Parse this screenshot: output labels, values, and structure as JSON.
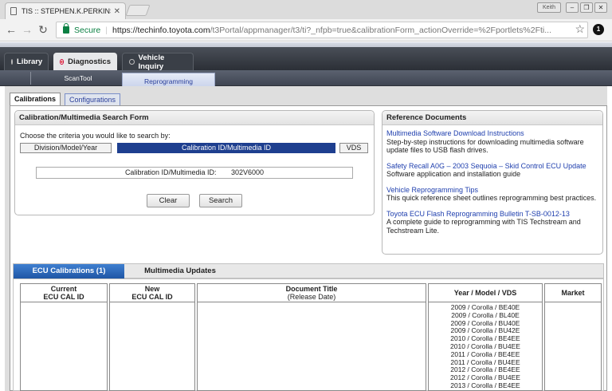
{
  "browser": {
    "tab_title": "TIS :: STEPHEN.K.PERKINS",
    "tab_close": "✕",
    "window_user": "Keith",
    "url_secure_label": "Secure",
    "url_host": "https://techinfo.toyota.com",
    "url_path": "/t3Portal/appmanager/t3/ti?_nfpb=true&calibrationForm_actionOverride=%2Fportlets%2Fti...",
    "ext_badge": "1"
  },
  "app_tabs": [
    {
      "label": "Library"
    },
    {
      "label": "Diagnostics"
    },
    {
      "label": "Vehicle Inquiry"
    }
  ],
  "sub_tabs": [
    {
      "label": "ScanTool"
    },
    {
      "label": "Reprogramming"
    }
  ],
  "cal_tabs": [
    {
      "label": "Calibrations"
    },
    {
      "label": "Configurations"
    }
  ],
  "search_form": {
    "title": "Calibration/Multimedia Search Form",
    "criteria_label": "Choose the criteria you would like to search by:",
    "criteria_buttons": [
      "Division/Model/Year",
      "Calibration ID/Multimedia ID",
      "VDS"
    ],
    "id_field_label": "Calibration ID/Multimedia ID:",
    "id_field_value": "302V6000",
    "clear_label": "Clear",
    "search_label": "Search"
  },
  "reference_docs": {
    "title": "Reference Documents",
    "items": [
      {
        "link": "Multimedia Software Download Instructions",
        "desc": "Step-by-step instructions for downloading multimedia software update files to USB flash drives."
      },
      {
        "link": "Safety Recall A0G – 2003 Sequoia – Skid Control ECU Update",
        "desc": "Software application and installation guide"
      },
      {
        "link": "Vehicle Reprogramming Tips",
        "desc": "This quick reference sheet outlines reprogramming best practices."
      },
      {
        "link": "Toyota ECU Flash Reprogramming Bulletin T-SB-0012-13",
        "desc": "A complete guide to reprogramming with TIS Techstream and Techstream Lite."
      }
    ]
  },
  "results": {
    "tabs": [
      "ECU Calibrations (1)",
      "Multimedia Updates"
    ],
    "columns": {
      "current_a": "Current",
      "current_b": "ECU CAL ID",
      "new_a": "New",
      "new_b": "ECU CAL ID",
      "doc_a": "Document Title",
      "doc_b": "(Release Date)",
      "ymv": "Year / Model / VDS",
      "market": "Market"
    },
    "year_model_vds": "2009 / Corolla / BE40E\n2009 / Corolla / BL40E\n2009 / Corolla / BU40E\n2009 / Corolla / BU42E\n2010 / Corolla / BE4EE\n2010 / Corolla / BU4EE\n2011 / Corolla / BE4EE\n2011 / Corolla / BU4EE\n2012 / Corolla / BE4EE\n2012 / Corolla / BU4EE\n2013 / Corolla / BE4EE"
  },
  "colors": {
    "selected_blue": "#1e3f8f",
    "link_blue": "#1f3fae",
    "secure_green": "#0b8043"
  }
}
